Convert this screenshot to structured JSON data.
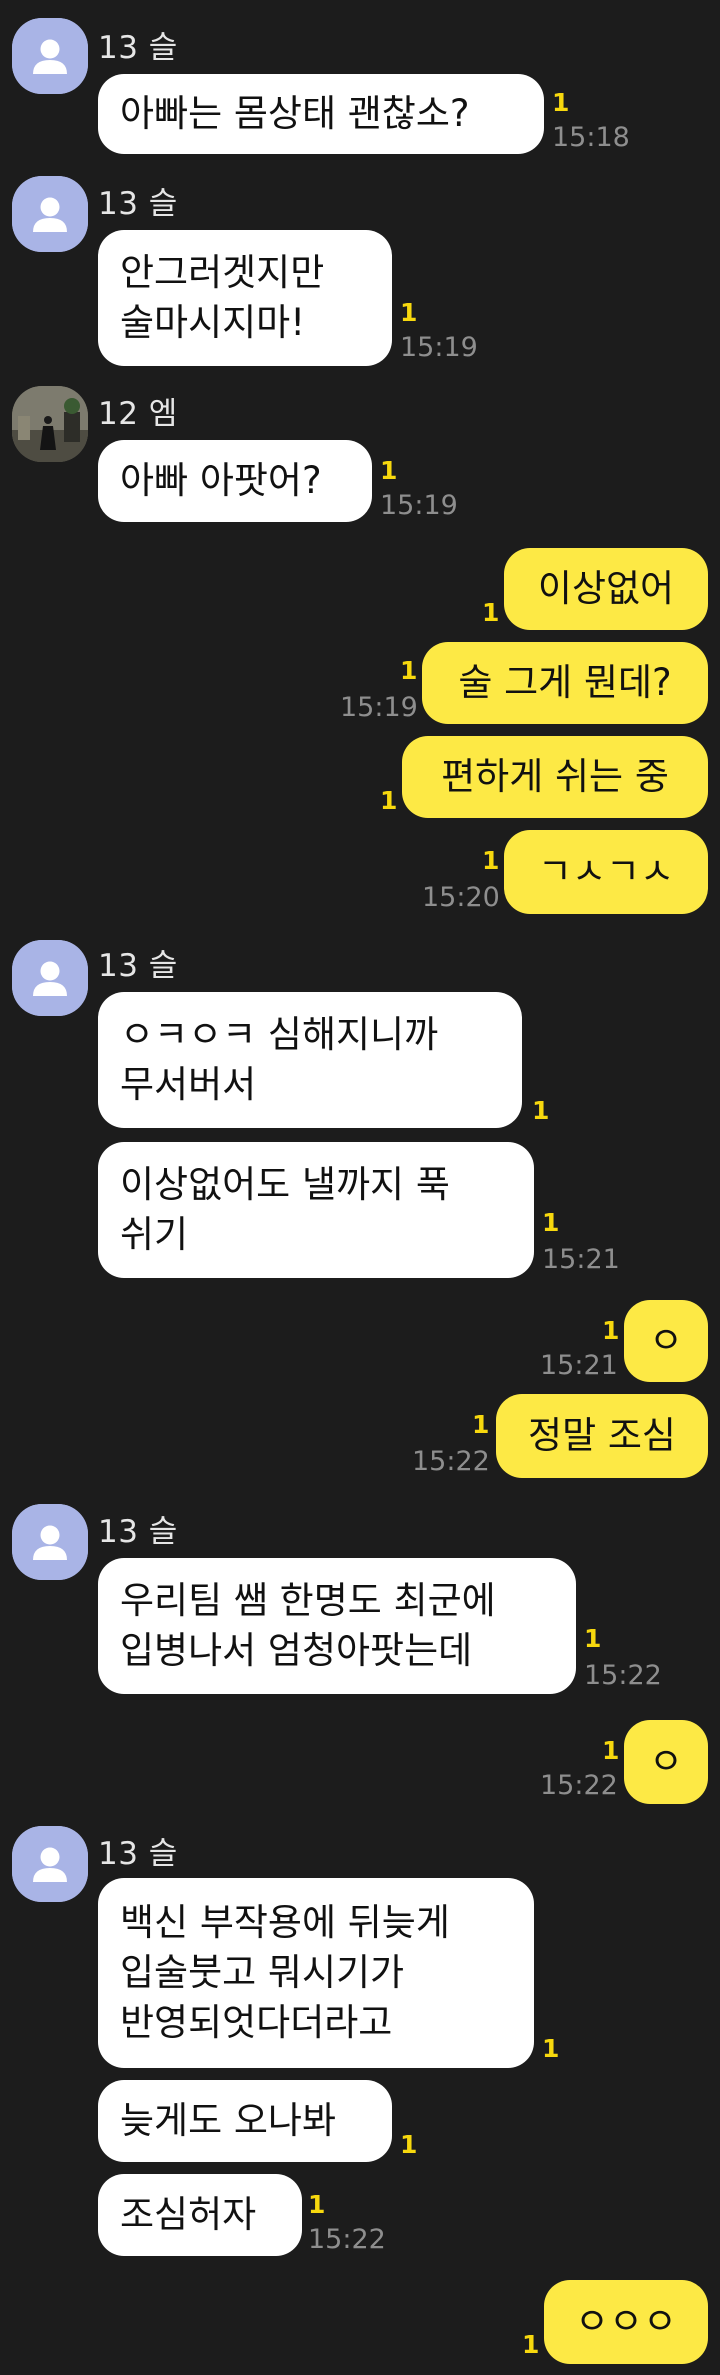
{
  "colors": {
    "background": "#1c1c1c",
    "incoming_bubble": "#ffffff",
    "outgoing_bubble": "#fde945",
    "unread_count": "#f7d80e",
    "timestamp": "#8e8e8e",
    "default_avatar": "#a9b4e6"
  },
  "messages": [
    {
      "sender": "13 슬",
      "lines": [
        "아빠는 몸상태 괜찮소?"
      ],
      "unread": "1",
      "time": "15:18"
    },
    {
      "sender": "13 슬",
      "lines": [
        "안그러겟지만",
        "술마시지마!"
      ],
      "unread": "1",
      "time": "15:19"
    },
    {
      "sender": "12 엠",
      "lines": [
        "아빠 아팟어?"
      ],
      "unread": "1",
      "time": "15:19"
    },
    {
      "lines": [
        "이상없어"
      ],
      "unread": "1",
      "time": ""
    },
    {
      "lines": [
        "술 그게 뭔데?"
      ],
      "unread": "1",
      "time": "15:19"
    },
    {
      "lines": [
        "편하게 쉬는 중"
      ],
      "unread": "1",
      "time": ""
    },
    {
      "lines": [
        "ㄱㅅㄱㅅ"
      ],
      "unread": "1",
      "time": "15:20"
    },
    {
      "sender": "13 슬",
      "lines": [
        "ㅇㅋㅇㅋ 심해지니까",
        "무서버서"
      ],
      "unread": "1",
      "time": ""
    },
    {
      "lines": [
        "이상없어도 낼까지 푹",
        "쉬기"
      ],
      "unread": "1",
      "time": "15:21"
    },
    {
      "lines": [
        "ㅇ"
      ],
      "unread": "1",
      "time": "15:21"
    },
    {
      "lines": [
        "정말 조심"
      ],
      "unread": "1",
      "time": "15:22"
    },
    {
      "sender": "13 슬",
      "lines": [
        "우리팀 쌤 한명도 최군에",
        "입병나서 엄청아팟는데"
      ],
      "unread": "1",
      "time": "15:22"
    },
    {
      "lines": [
        "ㅇ"
      ],
      "unread": "1",
      "time": "15:22"
    },
    {
      "sender": "13 슬",
      "lines": [
        "백신 부작용에 뒤늦게",
        "입술붓고 뭐시기가",
        "반영되엇다더라고"
      ],
      "unread": "1",
      "time": ""
    },
    {
      "lines": [
        "늦게도 오나봐"
      ],
      "unread": "1",
      "time": ""
    },
    {
      "lines": [
        "조심허자"
      ],
      "unread": "1",
      "time": "15:22"
    },
    {
      "lines": [
        "ㅇㅇㅇ"
      ],
      "unread": "1",
      "time": ""
    }
  ]
}
